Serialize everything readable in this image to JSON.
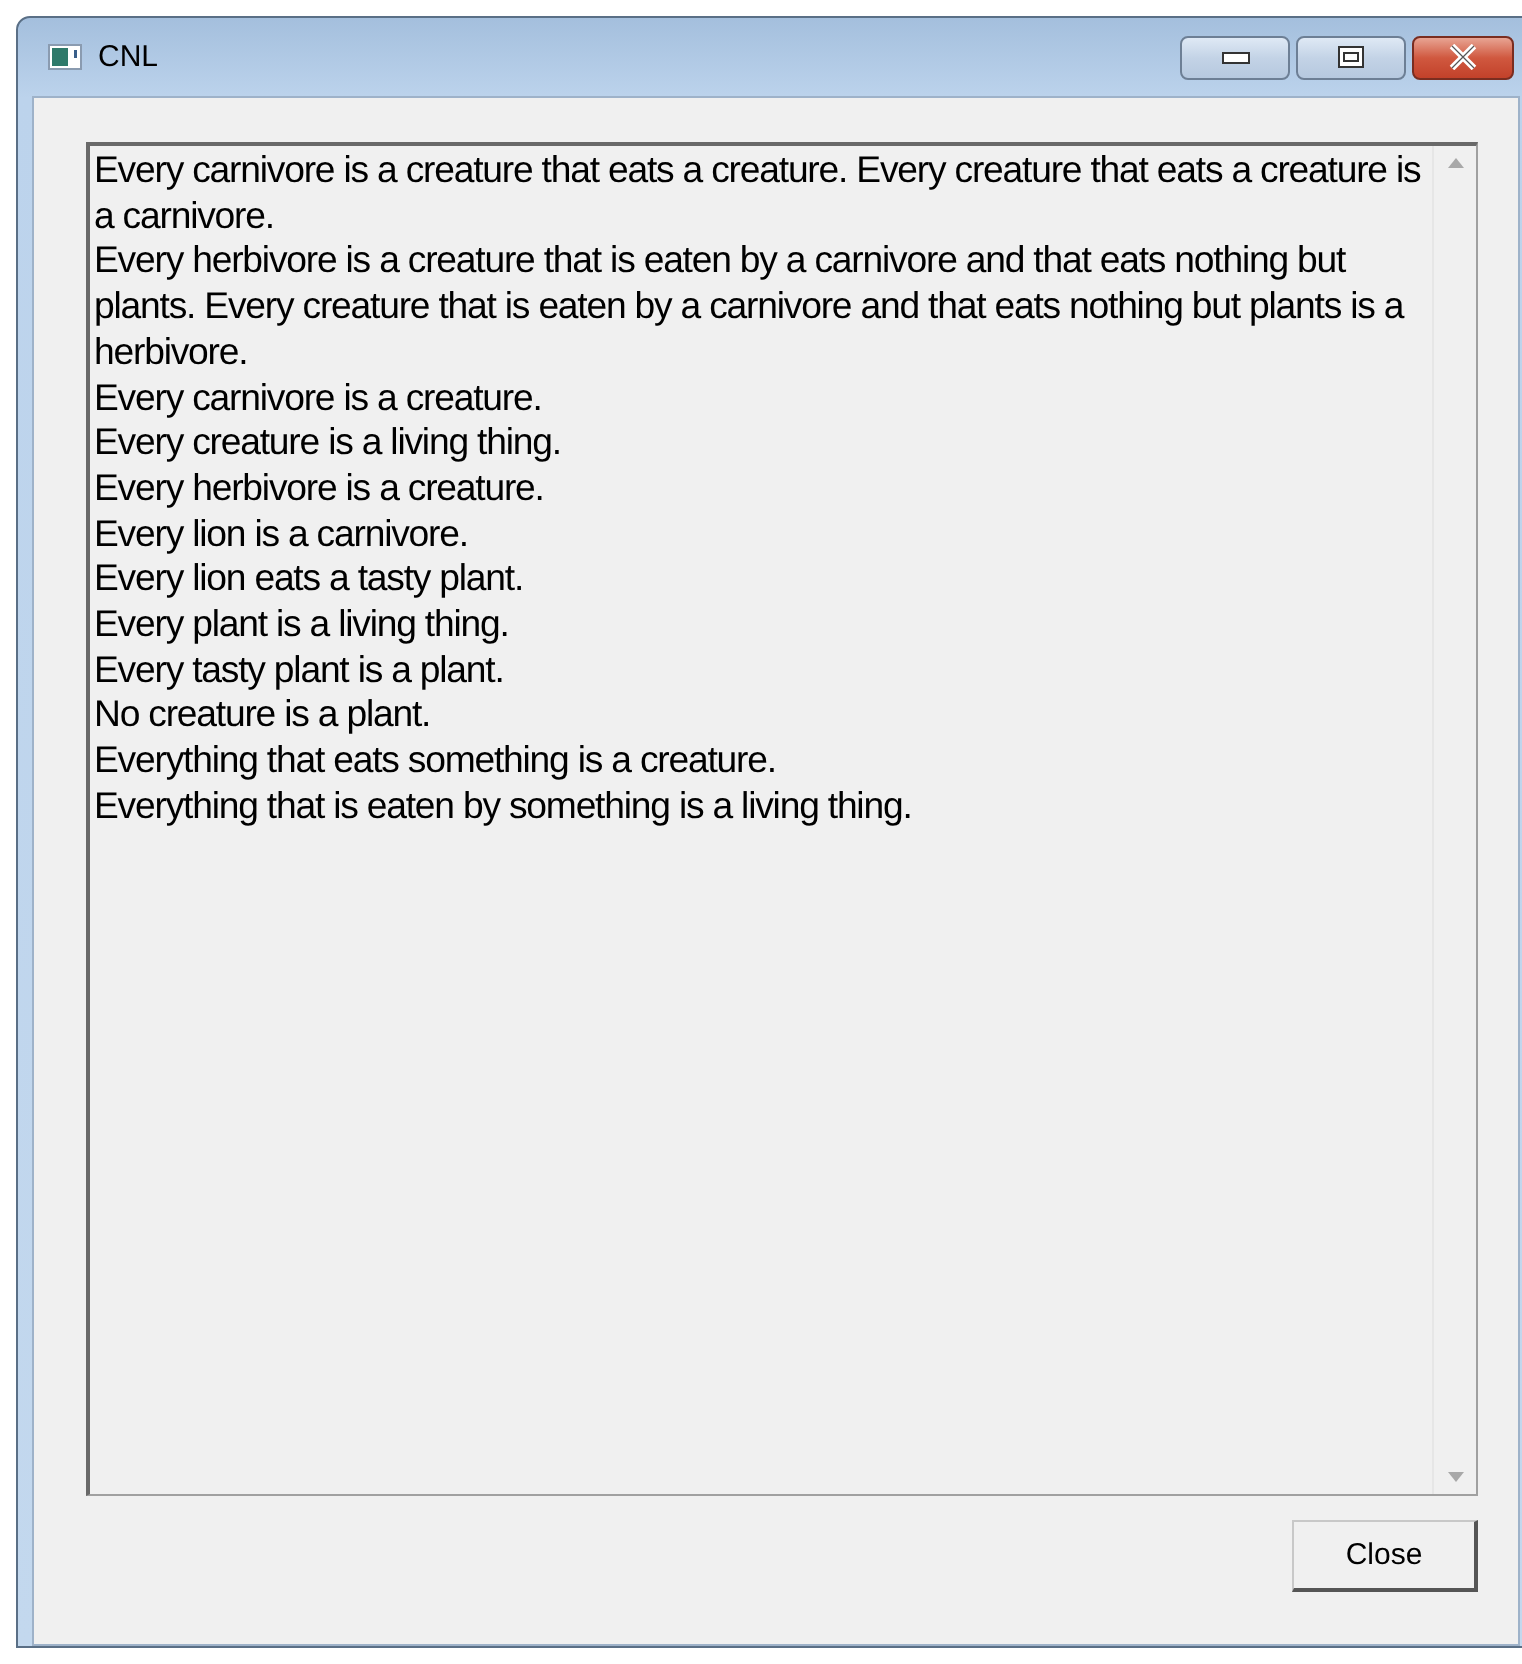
{
  "window": {
    "title": "CNL"
  },
  "text_area": {
    "lines": [
      "Every carnivore is a creature that eats a creature. Every creature that eats a creature is a carnivore.",
      "Every herbivore is a creature that is eaten by a carnivore and that eats nothing but plants. Every creature that is eaten by a carnivore and that eats nothing but plants is a herbivore.",
      "Every carnivore is a creature.",
      "Every creature is a living thing.",
      "Every herbivore is a creature.",
      "Every lion is a carnivore.",
      "Every lion eats a tasty plant.",
      "Every plant is a living thing.",
      "Every tasty plant is a plant.",
      "No creature is a plant.",
      "Everything that eats something is a creature.",
      "Everything that is eaten by something is a living thing."
    ]
  },
  "buttons": [
    "Close"
  ]
}
